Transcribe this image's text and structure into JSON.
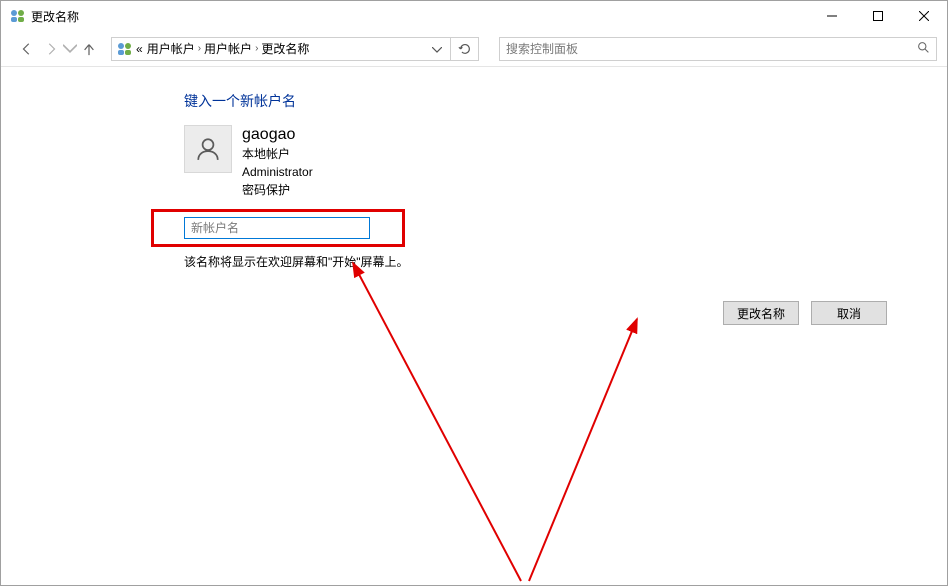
{
  "window": {
    "title": "更改名称"
  },
  "nav": {
    "path_root": "«",
    "crumb1": "用户帐户",
    "crumb2": "用户帐户",
    "crumb3": "更改名称"
  },
  "search": {
    "placeholder": "搜索控制面板"
  },
  "page": {
    "heading": "键入一个新帐户名",
    "account_name": "gaogao",
    "account_type": "本地帐户",
    "role": "Administrator",
    "protection": "密码保护",
    "input_placeholder": "新帐户名",
    "input_value": "",
    "hint": "该名称将显示在欢迎屏幕和\"开始\"屏幕上。"
  },
  "buttons": {
    "change": "更改名称",
    "cancel": "取消"
  }
}
